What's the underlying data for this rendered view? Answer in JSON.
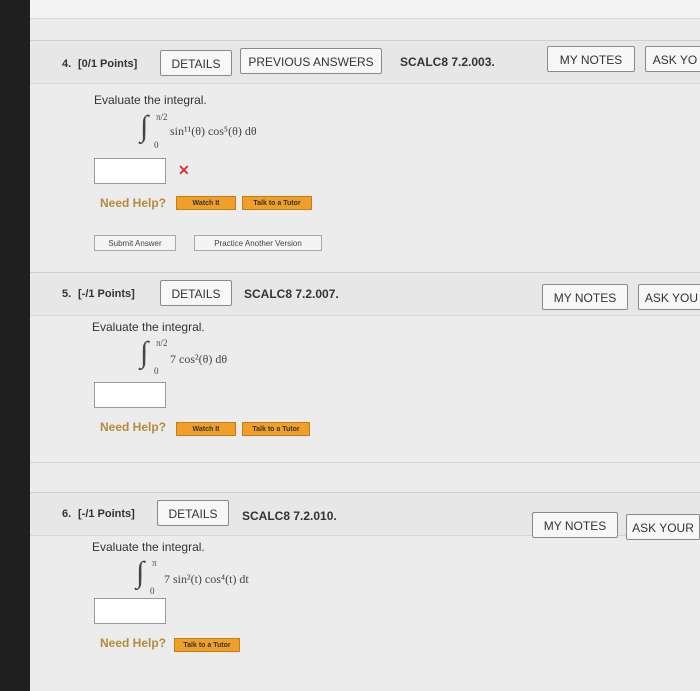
{
  "questions": [
    {
      "number": "4.",
      "points": "[0/1 Points]",
      "details": "DETAILS",
      "previous": "PREVIOUS ANSWERS",
      "code": "SCALC8 7.2.003.",
      "my_notes": "MY NOTES",
      "ask": "ASK YO",
      "prompt": "Evaluate the integral.",
      "upper": "π/2",
      "lower": "0",
      "integrand": "sin¹¹(θ) cos⁵(θ) dθ",
      "mark": "✕",
      "need_help": "Need Help?",
      "watch": "Watch It",
      "tutor": "Talk to a Tutor",
      "submit": "Submit Answer",
      "practice": "Practice Another Version"
    },
    {
      "number": "5.",
      "points": "[-/1 Points]",
      "details": "DETAILS",
      "code": "SCALC8 7.2.007.",
      "my_notes": "MY NOTES",
      "ask": "ASK YOU",
      "prompt": "Evaluate the integral.",
      "upper": "π/2",
      "lower": "0",
      "integrand": "7 cos²(θ) dθ",
      "need_help": "Need Help?",
      "watch": "Watch It",
      "tutor": "Talk to a Tutor"
    },
    {
      "number": "6.",
      "points": "[-/1 Points]",
      "details": "DETAILS",
      "code": "SCALC8 7.2.010.",
      "my_notes": "MY NOTES",
      "ask": "ASK YOUR",
      "prompt": "Evaluate the integral.",
      "upper": "π",
      "lower": "0",
      "integrand": "7 sin²(t) cos⁴(t) dt",
      "need_help": "Need Help?",
      "tutor": "Talk to a Tutor"
    }
  ],
  "colors": {
    "accent_orange": "#f0a02a",
    "need_help": "#b58a3a",
    "wrong": "#dd3333"
  }
}
